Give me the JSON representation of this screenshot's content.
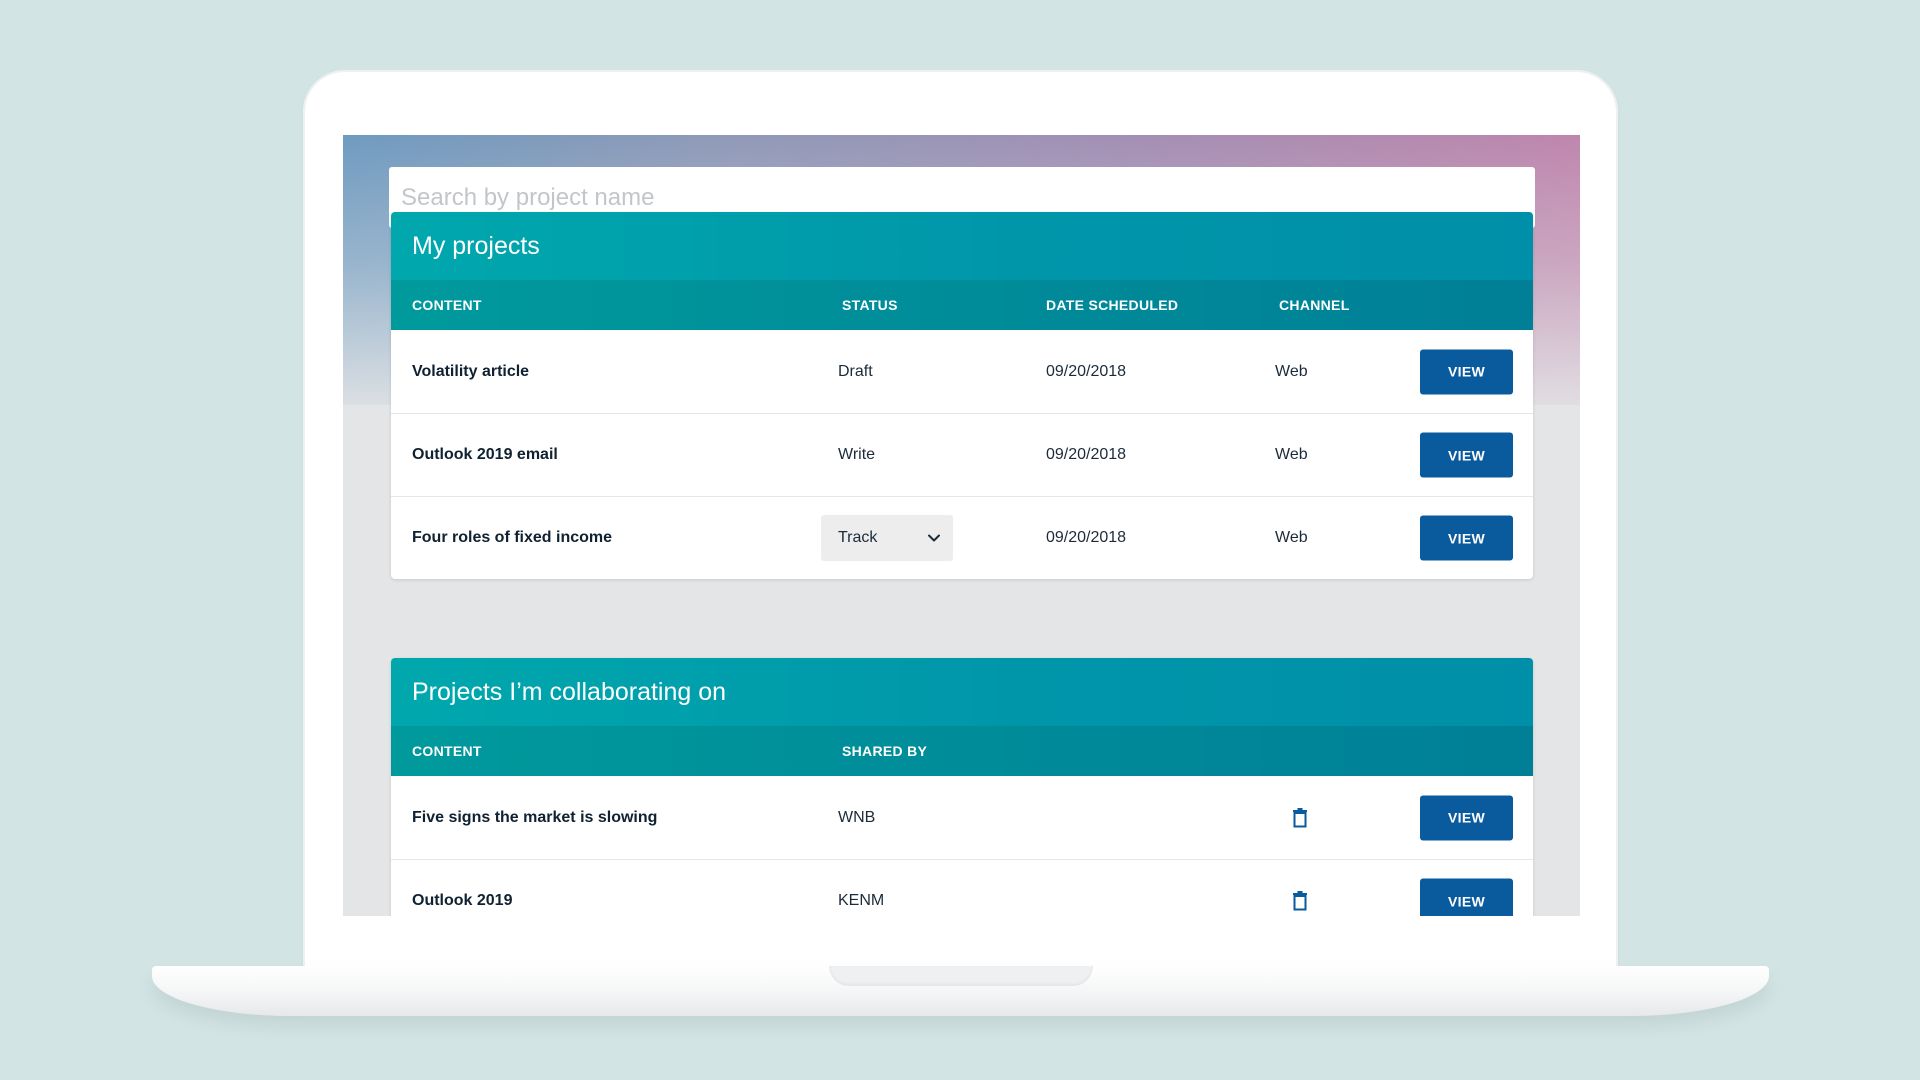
{
  "search": {
    "placeholder": "Search by project name",
    "value": ""
  },
  "my_projects": {
    "title": "My projects",
    "columns": {
      "content": "CONTENT",
      "status": "STATUS",
      "date": "DATE SCHEDULED",
      "channel": "CHANNEL"
    },
    "rows": [
      {
        "content": "Volatility article",
        "status": "Draft",
        "date": "09/20/2018",
        "channel": "Web",
        "action": "VIEW"
      },
      {
        "content": "Outlook 2019 email",
        "status": "Write",
        "date": "09/20/2018",
        "channel": "Web",
        "action": "VIEW"
      },
      {
        "content": "Four roles of fixed income",
        "status": "Track",
        "date": "09/20/2018",
        "channel": "Web",
        "action": "VIEW"
      }
    ]
  },
  "collab_projects": {
    "title": "Projects I’m collaborating on",
    "columns": {
      "content": "CONTENT",
      "shared_by": "SHARED BY"
    },
    "rows": [
      {
        "content": "Five signs the market is slowing",
        "shared_by": "WNB",
        "action": "VIEW"
      },
      {
        "content": "Outlook 2019",
        "shared_by": "KENM",
        "action": "VIEW"
      }
    ]
  },
  "icons": {
    "status_dropdown": "chevron-down-icon",
    "delete": "trash-icon"
  },
  "colors": {
    "background": "#d2e5e4",
    "card_header": "#00a8ad",
    "column_header": "#008b99",
    "button": "#0a5a9e",
    "gradient_left": "#6f9bc0",
    "gradient_right": "#bf86ad"
  }
}
